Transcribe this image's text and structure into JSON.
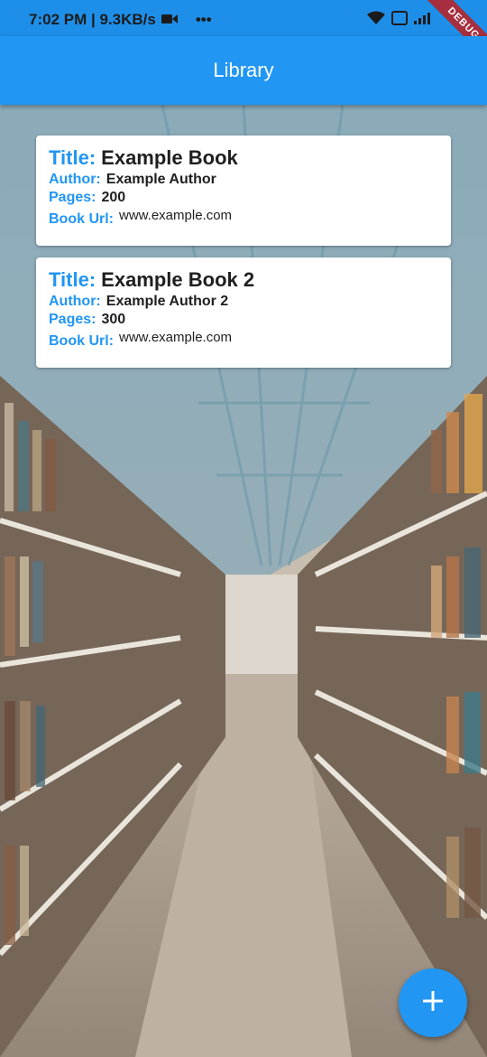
{
  "status_bar": {
    "time_and_speed": "7:02 PM | 9.3KB/s",
    "more": "•••",
    "debug_banner": "DEBUG"
  },
  "app_bar": {
    "title": "Library"
  },
  "books": [
    {
      "title_label": "Title:",
      "title": "Example Book",
      "author_label": "Author:",
      "author": "Example Author",
      "pages_label": "Pages:",
      "pages": "200",
      "url_label": "Book Url:",
      "url": "www.example.com"
    },
    {
      "title_label": "Title:",
      "title": "Example Book 2",
      "author_label": "Author:",
      "author": "Example Author 2",
      "pages_label": "Pages:",
      "pages": "300",
      "url_label": "Book Url:",
      "url": "www.example.com"
    }
  ],
  "fab": {
    "icon": "plus-icon"
  },
  "colors": {
    "primary": "#2196f3",
    "status_bar": "#1e8fe9",
    "debug": "#a62e3e"
  }
}
